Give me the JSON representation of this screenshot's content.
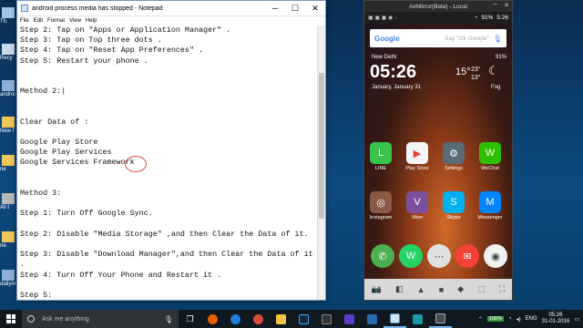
{
  "notepad": {
    "title": "android process media has stopped - Notepad",
    "menu": [
      "File",
      "Edit",
      "Format",
      "View",
      "Help"
    ],
    "lines": [
      "Step 2: Tap on \"Apps or Application Manager\" .",
      "Step 3: Tap on Top three dots .",
      "Step 4: Tap on \"Reset App Preferences\" .",
      "Step 5: Restart your phone .",
      "",
      "",
      "Method 2:|",
      "",
      "",
      "Clear Data of :",
      "",
      "Google Play Store",
      "Google Play Services",
      "Google Services Framework",
      "",
      "",
      "Method 3:",
      "",
      "Step 1: Turn Off Google Sync.",
      "",
      "Step 2: Disable \"Media Storage\" ,and then Clear the Data of it.",
      "",
      "Step 3: Disable \"Download Manager\",and then Clear the Data of it",
      ".",
      "Step 4: Turn Off Your Phone and Restart it .",
      "",
      "Step 5:"
    ]
  },
  "desktop": {
    "icons": [
      {
        "label": "Th"
      },
      {
        "label": "Recy"
      },
      {
        "label": "androi"
      },
      {
        "label": "New f"
      },
      {
        "label": "ne"
      },
      {
        "label": "All t"
      },
      {
        "label": "ne"
      },
      {
        "label": "dailym"
      }
    ]
  },
  "phone": {
    "window_title": "AirMirror(Beta) - Local",
    "status_battery": "91%",
    "status_time": "5:26",
    "search_logo": "Google",
    "search_hint": "Say \"Ok Google\"",
    "city": "New Delhi",
    "widget_battery": "91%",
    "clock": "05:26",
    "date": "January, January 31",
    "temp_now": "15°",
    "temp_high": "23°",
    "temp_low": "13°",
    "condition": "Fog",
    "apps": [
      {
        "label": "LINE",
        "glyph": "L",
        "color": "#3ac34a"
      },
      {
        "label": "Play Store",
        "glyph": "▶",
        "color": "#f5f5f5"
      },
      {
        "label": "Settings",
        "glyph": "⚙",
        "color": "#5a6b78"
      },
      {
        "label": "WeChat",
        "glyph": "W",
        "color": "#2dc100"
      },
      {
        "label": "Instagram",
        "glyph": "◎",
        "color": "#8a5a44"
      },
      {
        "label": "Viber",
        "glyph": "V",
        "color": "#7b519d"
      },
      {
        "label": "Skype",
        "glyph": "S",
        "color": "#00aff0"
      },
      {
        "label": "Messenger",
        "glyph": "M",
        "color": "#0084ff"
      }
    ],
    "dock": [
      {
        "glyph": "✆",
        "color": "#4caf50"
      },
      {
        "glyph": "W",
        "color": "#25d366"
      },
      {
        "glyph": "⋯",
        "color": "#e0e0e0"
      },
      {
        "glyph": "✉",
        "color": "#f44336"
      },
      {
        "glyph": "◉",
        "color": "#f0f0f0"
      }
    ],
    "toolbar": [
      "📷",
      "◧",
      "▲",
      "■",
      "◆",
      "⬚",
      "⛶"
    ]
  },
  "taskbar": {
    "search_placeholder": "Ask me anything",
    "battery": "100%",
    "language": "ENG",
    "time": "05:26",
    "date": "31-01-2016"
  },
  "colors": {
    "taskbar_bg": "#101820",
    "notepad_bg": "#ffffff",
    "accent": "#7bb4ea"
  }
}
